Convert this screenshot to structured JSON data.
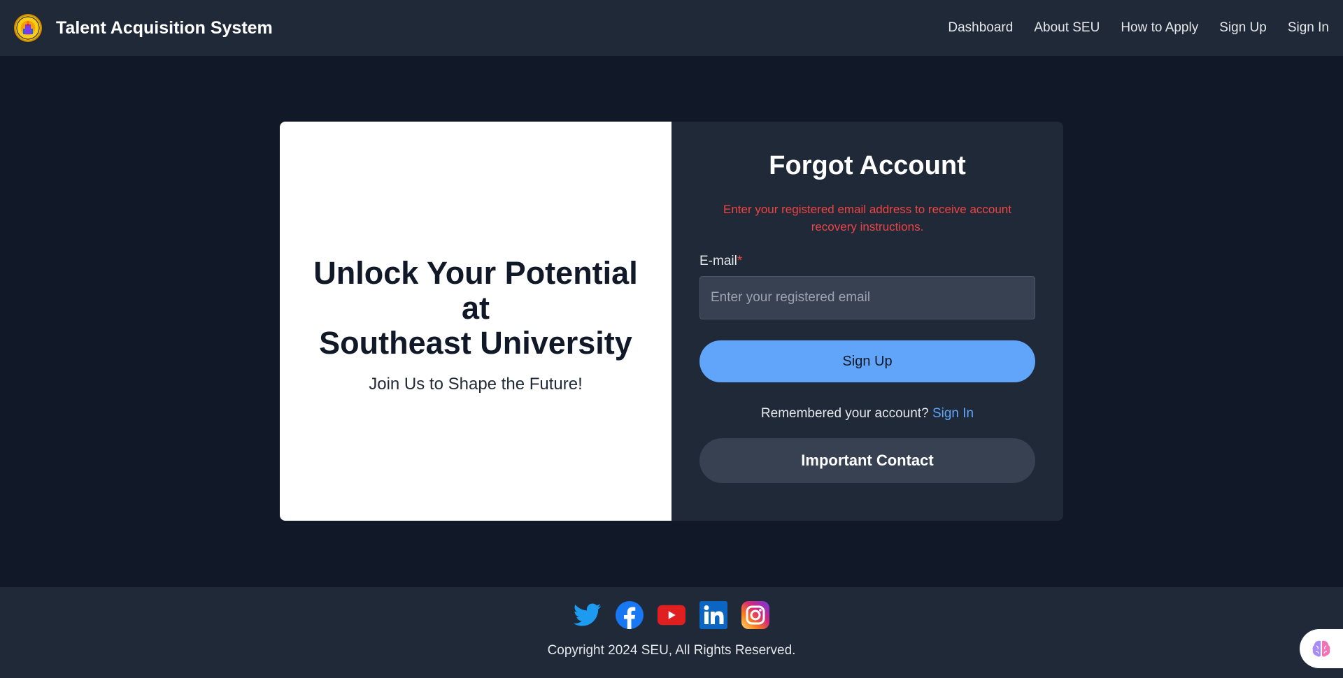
{
  "header": {
    "brand_title": "Talent Acquisition System",
    "logo_icon": "seu-logo-icon",
    "nav": [
      {
        "label": "Dashboard"
      },
      {
        "label": "About SEU"
      },
      {
        "label": "How to Apply"
      },
      {
        "label": "Sign Up"
      },
      {
        "label": "Sign In"
      }
    ]
  },
  "hero": {
    "title_line1": "Unlock Your Potential",
    "title_line2": "at",
    "title_line3": "Southeast University",
    "subtitle": "Join Us to Shape the Future!"
  },
  "form": {
    "title": "Forgot Account",
    "note": "Enter your registered email address to receive account recovery instructions.",
    "email_label": "E-mail",
    "required_mark": "*",
    "email_value": "",
    "email_placeholder": "Enter your registered email",
    "submit_label": "Sign Up",
    "remember_text": "Remembered your account?",
    "signin_link": "Sign In",
    "contact_label": "Important Contact"
  },
  "footer": {
    "socials": [
      "twitter-icon",
      "facebook-icon",
      "youtube-icon",
      "linkedin-icon",
      "instagram-icon"
    ],
    "copyright": "Copyright 2024 SEU, All Rights Reserved."
  },
  "colors": {
    "page_bg": "#111827",
    "panel_bg": "#1f2937",
    "accent": "#60a5fa",
    "error": "#ef4444"
  }
}
